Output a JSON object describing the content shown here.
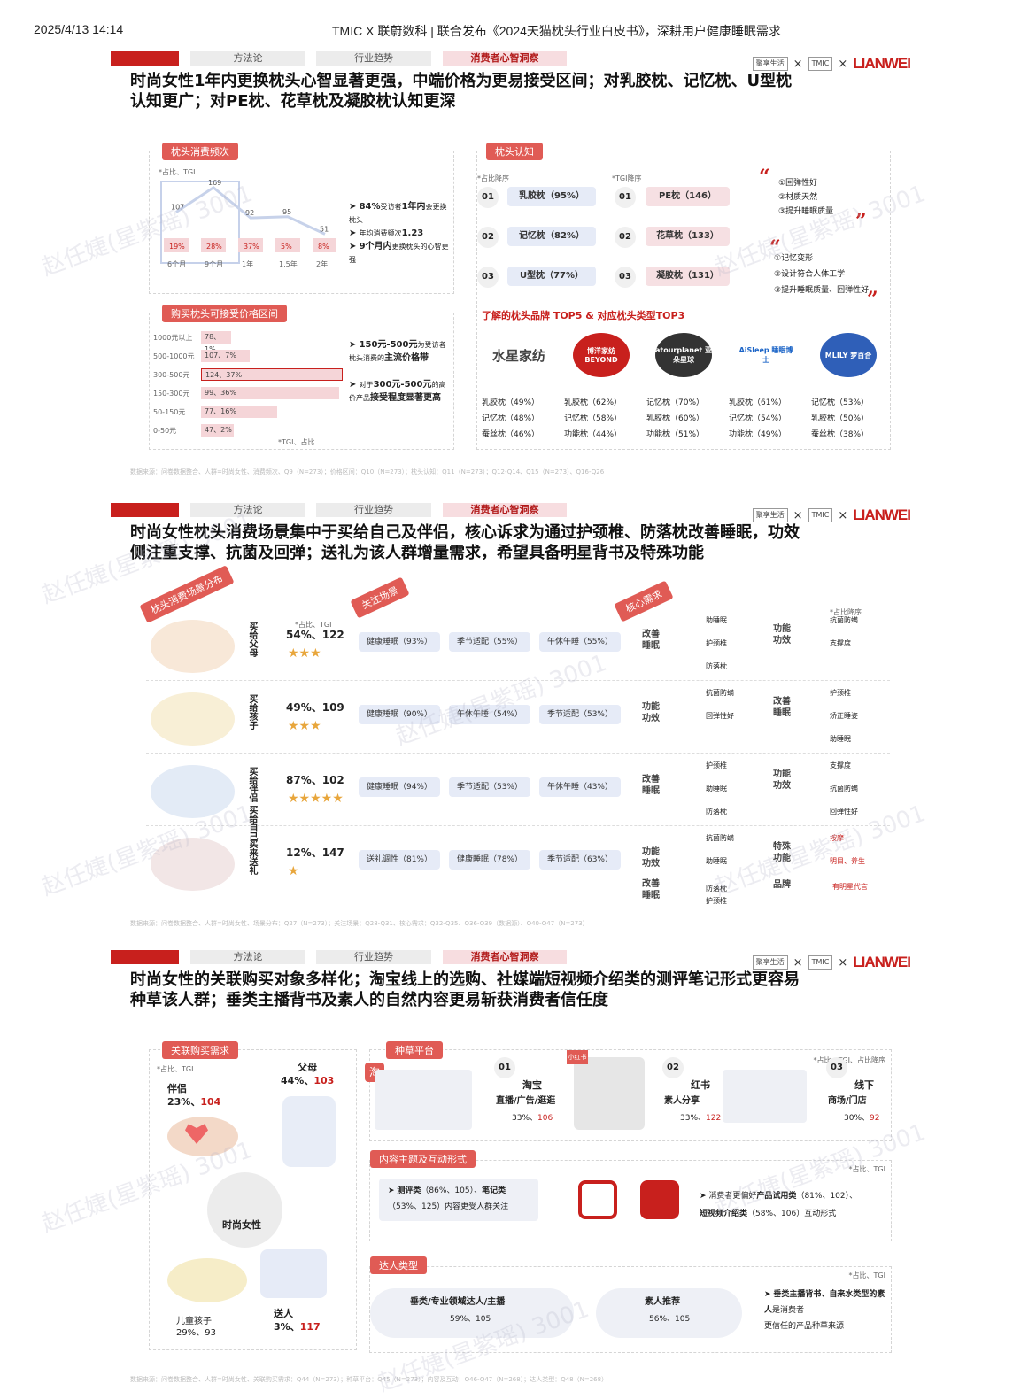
{
  "header": {
    "datetime": "2025/4/13 14:14",
    "title": "TMIC X 联蔚数科 | 联合发布《2024天猫枕头行业白皮书》，深耕用户健康睡眠需求"
  },
  "nav": {
    "tabs": [
      "方法论",
      "行业趋势",
      "消费者心智洞察"
    ]
  },
  "logos": {
    "brand1": "聚享生活",
    "x": "×",
    "brand2": "TMIC",
    "brand2_sub": "天猫新品创新中心",
    "brand3": "LIANWEI"
  },
  "watermark": "赵任婕(星紫瑶) 3001",
  "s1": {
    "headline": "时尚女性1年内更换枕头心智显著更强，中端价格为更易接受区间；对乳胶枕、记忆枕、U型枕认知更广；对PE枕、花草枕及凝胶枕认知更深",
    "freq": {
      "tag": "枕头消费频次",
      "note": "*占比、TGI",
      "tgi": [
        107,
        169,
        92,
        95,
        51
      ],
      "share": [
        "19%",
        "28%",
        "37%",
        "5%",
        "8%"
      ],
      "periods": [
        "6个月",
        "9个月",
        "1年",
        "1.5年",
        "2年"
      ],
      "b1a": "84%",
      "b1b": "受访者",
      "b1c": "1年内",
      "b1d": "会更换枕头",
      "b2a": "年均消费频次",
      "b2b": "1.23",
      "b3a": "9个月内",
      "b3b": "更换枕头的心智更强"
    },
    "price": {
      "tag": "购买枕头可接受价格区间",
      "rows": [
        {
          "label": "1000元以上",
          "val": "78、1%",
          "pct": 1
        },
        {
          "label": "500-1000元",
          "val": "107、7%",
          "pct": 7
        },
        {
          "label": "300-500元",
          "val": "124、37%",
          "pct": 37
        },
        {
          "label": "150-300元",
          "val": "99、36%",
          "pct": 36
        },
        {
          "label": "50-150元",
          "val": "77、16%",
          "pct": 16
        },
        {
          "label": "0-50元",
          "val": "47、2%",
          "pct": 2
        }
      ],
      "note": "*TGI、占比",
      "b1a": "150元-500元",
      "b1b": "为受访者枕头消费的",
      "b1c": "主流价格带",
      "b2a": "对于",
      "b2b": "300元-500元",
      "b2c": "的高价产品",
      "b2d": "接受程度显著更高"
    },
    "cog": {
      "tag": "枕头认知",
      "note1": "*占比降序",
      "note2": "*TGI降序",
      "left": [
        {
          "n": "01",
          "t": "乳胶枕（95%）"
        },
        {
          "n": "02",
          "t": "记忆枕（82%）"
        },
        {
          "n": "03",
          "t": "U型枕（77%）"
        }
      ],
      "right": [
        {
          "n": "01",
          "t": "PE枕（146）"
        },
        {
          "n": "02",
          "t": "花草枕（133）"
        },
        {
          "n": "03",
          "t": "凝胶枕（131）"
        }
      ],
      "q1": [
        "①回弹性好",
        "②材质天然",
        "③提升睡眠质量"
      ],
      "q2": [
        "①记忆变形",
        "②设计符合人体工学",
        "③提升睡眠质量、回弹性好"
      ],
      "brandTitle": "了解的枕头品牌 TOP5 & 对应枕头类型TOP3",
      "brands": [
        {
          "name": "水星家纺",
          "items": [
            "乳胶枕（49%）",
            "记忆枕（48%）",
            "蚕丝枕（46%）"
          ]
        },
        {
          "name": "博洋家纺 BEYOND",
          "items": [
            "乳胶枕（62%）",
            "记忆枕（58%）",
            "功能枕（44%）"
          ]
        },
        {
          "name": "atourplanet 亚朵星球",
          "items": [
            "记忆枕（70%）",
            "乳胶枕（60%）",
            "功能枕（51%）"
          ]
        },
        {
          "name": "AiSleep 睡眠博士",
          "items": [
            "乳胶枕（61%）",
            "记忆枕（54%）",
            "功能枕（49%）"
          ]
        },
        {
          "name": "MLILY 梦百合",
          "items": [
            "记忆枕（53%）",
            "乳胶枕（50%）",
            "蚕丝枕（38%）"
          ]
        }
      ],
      "quote_open": "“",
      "quote_close": "”"
    },
    "source": "数据来源：问卷数据整合、人群=时尚女性、消费频次、Q9（N=273）；价格区间：Q10（N=273）；枕头认知：Q11（N=273）；Q12-Q14、Q15（N=273）、Q16-Q26"
  },
  "s2": {
    "headline": "时尚女性枕头消费场景集中于买给自己及伴侣，核心诉求为通过护颈椎、防落枕改善睡眠，功效侧注重支撑、抗菌及回弹；送礼为该人群增量需求，希望具备明星背书及特殊功能",
    "tag1": "枕头消费场景分布",
    "tag2": "关注场景",
    "tag3": "核心需求",
    "note1": "*占比、TGI",
    "note2": "*占比降序",
    "rows": [
      {
        "who": "买给父母",
        "share": "54%、122",
        "stars": "★★★",
        "pills": [
          "健康睡眠（93%）",
          "季节适配（55%）",
          "午休午睡（55%）"
        ],
        "need1": "改善睡眠",
        "n1": [
          "助睡眠",
          "护颈椎",
          "防落枕"
        ],
        "need2": "功能功效",
        "n2": [
          "抗菌防螨",
          "支撑度"
        ]
      },
      {
        "who": "买给孩子",
        "share": "49%、109",
        "stars": "★★★",
        "pills": [
          "健康睡眠（90%）",
          "午休午睡（54%）",
          "季节适配（53%）"
        ],
        "need1": "功能功效",
        "n1": [
          "抗菌防螨",
          "回弹性好"
        ],
        "need2": "改善睡眠",
        "n2": [
          "护颈椎",
          "矫正睡姿",
          "助睡眠"
        ]
      },
      {
        "who": "买给伴侣 买给自己",
        "share": "87%、102",
        "stars": "★★★★★",
        "pills": [
          "健康睡眠（94%）",
          "季节适配（53%）",
          "午休午睡（43%）"
        ],
        "need1": "改善睡眠",
        "n1": [
          "护颈椎",
          "助睡眠",
          "防落枕"
        ],
        "need2": "功能功效",
        "n2": [
          "支撑度",
          "抗菌防螨",
          "回弹性好"
        ]
      },
      {
        "who": "买来送礼",
        "share": "12%、147",
        "stars": "★",
        "pills": [
          "送礼调性（81%）",
          "健康睡眠（78%）",
          "季节适配（63%）"
        ],
        "need1": "功能功效",
        "n1": [
          "抗菌防螨",
          "助睡眠"
        ],
        "need1b": "改善睡眠",
        "n1b": [
          "防落枕",
          "护颈椎"
        ],
        "need2": "特殊功能",
        "n2": [
          "按摩",
          "明目、养生"
        ],
        "need3": "品牌",
        "n3": [
          "有明星代言"
        ]
      }
    ],
    "source": "数据来源：问卷数据整合、人群=时尚女性、场景分布：Q27（N=273）；关注场景：Q28-Q31、核心需求：Q32-Q35、Q36-Q39（数据源）、Q40-Q47（N=273）"
  },
  "s3": {
    "headline": "时尚女性的关联购买对象多样化；淘宝线上的选购、社媒端短视频介绍类的测评笔记形式更容易种草该人群；垂类主播背书及素人的自然内容更易斩获消费者信任度",
    "rel": {
      "tag": "关联购买需求",
      "note": "*占比、TGI",
      "partner": "伴侣",
      "partner_v1": "23%、",
      "partner_v2": "104",
      "parent": "父母",
      "parent_v1": "44%、",
      "parent_v2": "103",
      "center": "时尚女性",
      "child": "儿童孩子",
      "child_v": "29%、93",
      "gift": "送人",
      "gift_v1": "3%、",
      "gift_v2": "117"
    },
    "plant": {
      "tag": "种草平台",
      "note": "*占比、TGI、占比降序",
      "items": [
        {
          "n": "01",
          "name": "淘宝",
          "desc": "直播/广告/逛逛",
          "v1": "33%、",
          "v2": "106"
        },
        {
          "n": "02",
          "name": "红书",
          "desc": "素人分享",
          "v1": "33%、",
          "v2": "122"
        },
        {
          "n": "03",
          "name": "线下",
          "desc": "商场/门店",
          "v1": "30%、",
          "v2": "92"
        }
      ],
      "tb": "淘",
      "xhs": "小红书"
    },
    "content": {
      "tag": "内容主题及互动形式",
      "note": "*占比、TGI",
      "l1a": "测评类",
      "l1b": "（86%、105）、",
      "l1c": "笔记类",
      "l1d": "（53%、125）内容更受人群关注",
      "r1": "消费者更偏好",
      "r2": "产品试用类",
      "r3": "（81%、102）、",
      "r4": "短视频介绍类",
      "r5": "（58%、106）互动形式"
    },
    "kol": {
      "tag": "达人类型",
      "note": "*占比、TGI",
      "a": "垂类/专业领域达人/主播",
      "av": "59%、105",
      "b": "素人推荐",
      "bv": "56%、105",
      "c1": "垂类主播背书、自来水类型的素人",
      "c2": "是消费者",
      "c3": "更信任的产品种草来源"
    },
    "source": "数据来源：问卷数据整合、人群=时尚女性、关联购买需求：Q44（N=273）；种草平台：Q45（N=273）；内容及互动：Q46-Q47（N=268）；达人类型：Q48（N=268）"
  },
  "colors": {
    "red": "#c8201d",
    "pink": "#f6e0e3",
    "blue": "#e6ebf7"
  }
}
